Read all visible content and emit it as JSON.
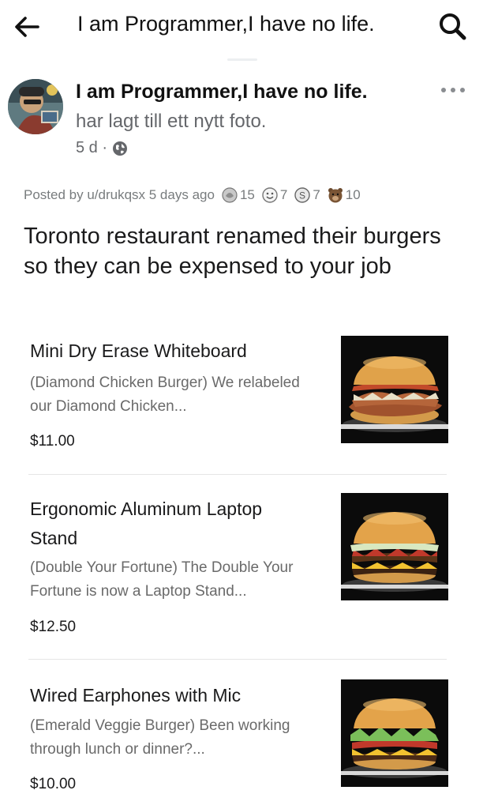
{
  "topbar": {
    "title": "I am Programmer,I have no life.",
    "back_icon": "arrow-left-icon",
    "search_icon": "search-icon"
  },
  "post": {
    "page_name": "I am Programmer,I have no life.",
    "subtitle": "har lagt till ett nytt foto.",
    "time": "5 d ·",
    "privacy_icon": "globe-icon",
    "more_icon": "more-horizontal-icon"
  },
  "reddit": {
    "posted_by": "Posted by u/drukqsx 5 days ago",
    "awards": [
      {
        "icon": "silver-award-icon",
        "count": "15"
      },
      {
        "icon": "wholesome-award-icon",
        "count": "7"
      },
      {
        "icon": "coin-award-icon",
        "count": "7"
      },
      {
        "icon": "bear-award-icon",
        "count": "10"
      }
    ],
    "headline": "Toronto restaurant renamed their burgers so they can be expensed to your job"
  },
  "menu": [
    {
      "name": "Mini Dry Erase Whiteboard",
      "description": "(Diamond Chicken Burger) We relabeled our Diamond Chicken...",
      "price": "$11.00"
    },
    {
      "name": "Ergonomic Aluminum Laptop Stand",
      "description": "(Double Your Fortune) The Double Your Fortune is now a Laptop Stand...",
      "price": "$12.50"
    },
    {
      "name": "Wired Earphones with Mic",
      "description": "(Emerald Veggie Burger) Been working through lunch or dinner?...",
      "price": "$10.00"
    }
  ],
  "colors": {
    "text_primary": "#1c1e21",
    "text_secondary": "#65676b",
    "reddit_meta": "#787c7e",
    "separator": "#e6e6e6"
  }
}
